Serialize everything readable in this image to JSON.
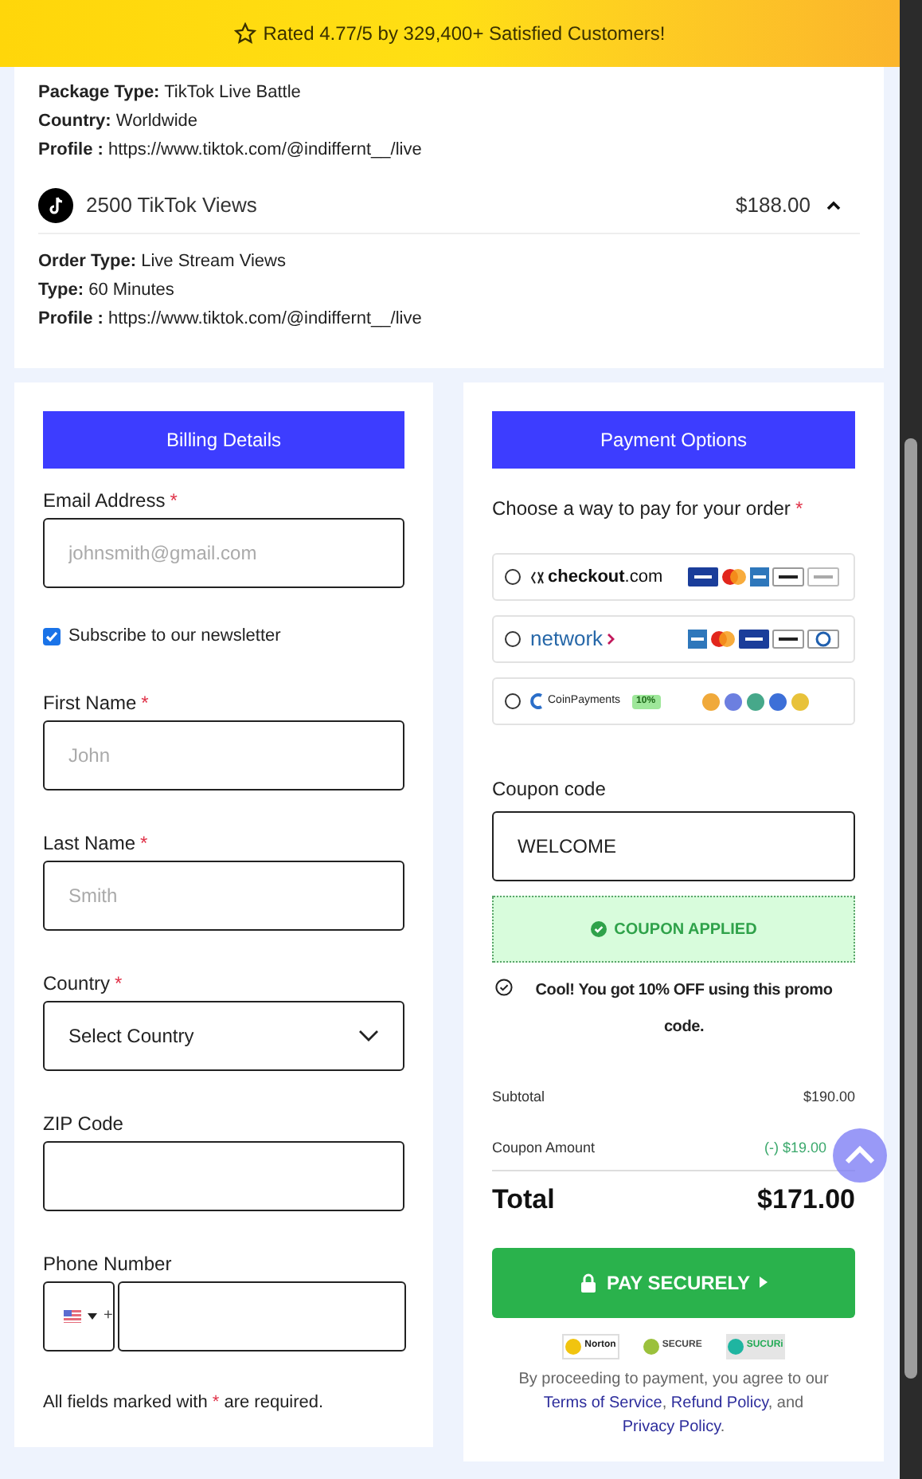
{
  "banner": {
    "text": "Rated 4.77/5 by 329,400+ Satisfied Customers!"
  },
  "order_items": [
    {
      "kind": "continuation",
      "details": [
        {
          "label": "Package Type:",
          "value": "TikTok Live Battle"
        },
        {
          "label": "Country:",
          "value": "Worldwide"
        },
        {
          "label": "Profile :",
          "value": "https://www.tiktok.com/@indiffernt__/live"
        }
      ]
    },
    {
      "kind": "item",
      "name": "2500 TikTok Views",
      "price": "$188.00",
      "expanded": true,
      "details": [
        {
          "label": "Order Type:",
          "value": "Live Stream Views"
        },
        {
          "label": "Type:",
          "value": "60 Minutes"
        },
        {
          "label": "Profile :",
          "value": "https://www.tiktok.com/@indiffernt__/live"
        }
      ]
    }
  ],
  "billing": {
    "title": "Billing Details",
    "fields": [
      {
        "kind": "input",
        "label": "Email Address",
        "required": true,
        "placeholder": "johnsmith@gmail.com"
      },
      {
        "kind": "checkbox",
        "label": "Subscribe to our newsletter",
        "checked": true
      },
      {
        "kind": "input",
        "label": "First Name",
        "required": true,
        "placeholder": "John"
      },
      {
        "kind": "input",
        "label": "Last Name",
        "required": true,
        "placeholder": "Smith"
      },
      {
        "kind": "select",
        "label": "Country",
        "required": true,
        "value": "Select Country"
      },
      {
        "kind": "input",
        "label": "ZIP Code",
        "required": false
      },
      {
        "kind": "phone",
        "label": "Phone Number",
        "required": false,
        "code": "+"
      }
    ],
    "note_before": "All fields marked with",
    "note_mark": "*",
    "note_after": "are required."
  },
  "payment": {
    "title": "Payment Options",
    "prompt": "Choose a way to pay for your order",
    "prompt_required": true,
    "options": [
      {
        "kind": "checkout",
        "brand": "checkout",
        "brand_suffix": ".com",
        "selected": false,
        "badges": [
          {
            "kind": "visa"
          },
          {
            "kind": "mastercard"
          },
          {
            "kind": "amex"
          },
          {
            "kind": "applepay"
          },
          {
            "kind": "gpay"
          }
        ]
      },
      {
        "kind": "network",
        "brand": "network",
        "selected": false,
        "badges": [
          {
            "kind": "amex"
          },
          {
            "kind": "mastercard"
          },
          {
            "kind": "visa"
          },
          {
            "kind": "applepay"
          },
          {
            "kind": "diners"
          }
        ]
      },
      {
        "kind": "coinpayments",
        "brand": "CoinPayments",
        "tag": "10%",
        "selected": false,
        "badges": [
          {
            "color": "#f0a93a"
          },
          {
            "color": "#6c7fe0"
          },
          {
            "color": "#46a88a"
          },
          {
            "color": "#3c6fd8"
          },
          {
            "color": "#e8c23a"
          }
        ]
      }
    ],
    "coupon_label": "Coupon code",
    "coupon_value": "WELCOME",
    "coupon_status": "COUPON APPLIED",
    "coupon_applied": true,
    "coupon_message": "Cool! You got 10% OFF using this promo code.",
    "subtotal_label": "Subtotal",
    "subtotal": "$190.00",
    "discount_label": "Coupon Amount",
    "discount": "(-) $19.00",
    "total_label": "Total",
    "total": "$171.00",
    "pay_button": "PAY SECURELY",
    "trust_badges": [
      "Norton",
      "SECURE",
      "SUCURi"
    ],
    "legal": [
      {
        "kind": "text",
        "text": "By proceeding to payment, you agree to our "
      },
      {
        "kind": "link",
        "text": "Terms of Service"
      },
      {
        "kind": "text",
        "text": ", "
      },
      {
        "kind": "link",
        "text": "Refund Policy"
      },
      {
        "kind": "text",
        "text": ", and "
      },
      {
        "kind": "link",
        "text": "Privacy Policy"
      },
      {
        "kind": "text",
        "text": "."
      }
    ]
  }
}
